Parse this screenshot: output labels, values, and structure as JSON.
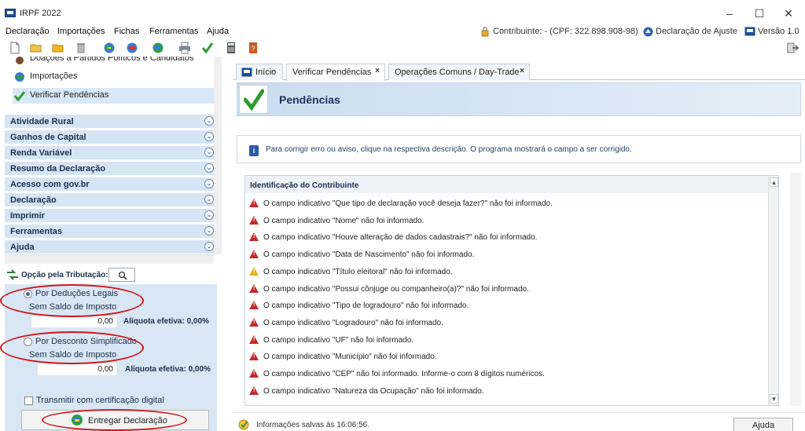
{
  "window": {
    "title": "IRPF 2022",
    "minimize": "–",
    "maximize": "☐",
    "close": "✕"
  },
  "menu": {
    "items": [
      "Declaração",
      "Importações",
      "Fichas",
      "Ferramentas",
      "Ajuda"
    ],
    "contribuinte": "Contribuinte:  - (CPF: 322.898.908-98)",
    "declaracao_tipo": "Declaração de Ajuste",
    "versao": "Versão 1.0"
  },
  "sidebar": {
    "top_items": [
      "Doações a Partidos Políticos e Candidatos",
      "Importações",
      "Verificar Pendências"
    ],
    "sections": [
      "Atividade Rural",
      "Ganhos de Capital",
      "Renda Variável",
      "Resumo da Declaração",
      "Acesso com gov.br",
      "Declaração",
      "Imprimir",
      "Ferramentas",
      "Ajuda"
    ]
  },
  "tributacao": {
    "label": "Opção pela Tributação:",
    "opcoes": [
      {
        "label": "Por Deduções Legais",
        "saldo": "Sem Saldo de Imposto",
        "valor": "0,00",
        "aliquota": "Alíquota efetiva: 0,00%",
        "selected": true
      },
      {
        "label": "Por Desconto Simplificado",
        "saldo": "Sem Saldo de Imposto",
        "valor": "0,00",
        "aliquota": "Alíquota efetiva: 0,00%",
        "selected": false
      }
    ],
    "certificado": "Transmitir com certificação digital",
    "entregar": "Entregar Declaração"
  },
  "tabs": [
    {
      "label": "Início",
      "closable": false
    },
    {
      "label": "Verificar Pendências",
      "closable": true
    },
    {
      "label": "Operações Comuns / Day-Trade",
      "closable": true
    }
  ],
  "pendencias": {
    "title": "Pendências",
    "info": "Para corrigir erro ou aviso, clique na respectiva descrição. O programa mostrará o campo a ser corrigido.",
    "group": "Identificação do Contribuinte",
    "items": [
      {
        "type": "error",
        "text": "O campo indicativo \"Que tipo de declaração você deseja fazer?\" não foi informado."
      },
      {
        "type": "error",
        "text": "O campo indicativo \"Nome\" não foi informado."
      },
      {
        "type": "error",
        "text": "O campo indicativo \"Houve alteração de dados cadastrais?\" não foi informado."
      },
      {
        "type": "error",
        "text": "O campo indicativo \"Data de Nascimento\" não foi informado."
      },
      {
        "type": "warning",
        "text": "O campo indicativo \"Título eleitoral\" não foi informado."
      },
      {
        "type": "error",
        "text": "O campo indicativo \"Possui cônjuge ou companheiro(a)?\" não foi informado."
      },
      {
        "type": "error",
        "text": "O campo indicativo \"Tipo de logradouro\" não foi informado."
      },
      {
        "type": "error",
        "text": "O campo indicativo \"Logradouro\" não foi informado."
      },
      {
        "type": "error",
        "text": "O campo indicativo \"UF\" não foi informado."
      },
      {
        "type": "error",
        "text": "O campo indicativo \"Município\" não foi informado."
      },
      {
        "type": "error",
        "text": "O campo indicativo \"CEP\" não foi informado. Informe-o com 8 dígitos numéricos."
      },
      {
        "type": "error",
        "text": "O campo indicativo \"Natureza da Ocupação\" não foi informado."
      }
    ]
  },
  "status": {
    "text": "Informações salvas às 16:06:56.",
    "ajuda": "Ajuda"
  }
}
